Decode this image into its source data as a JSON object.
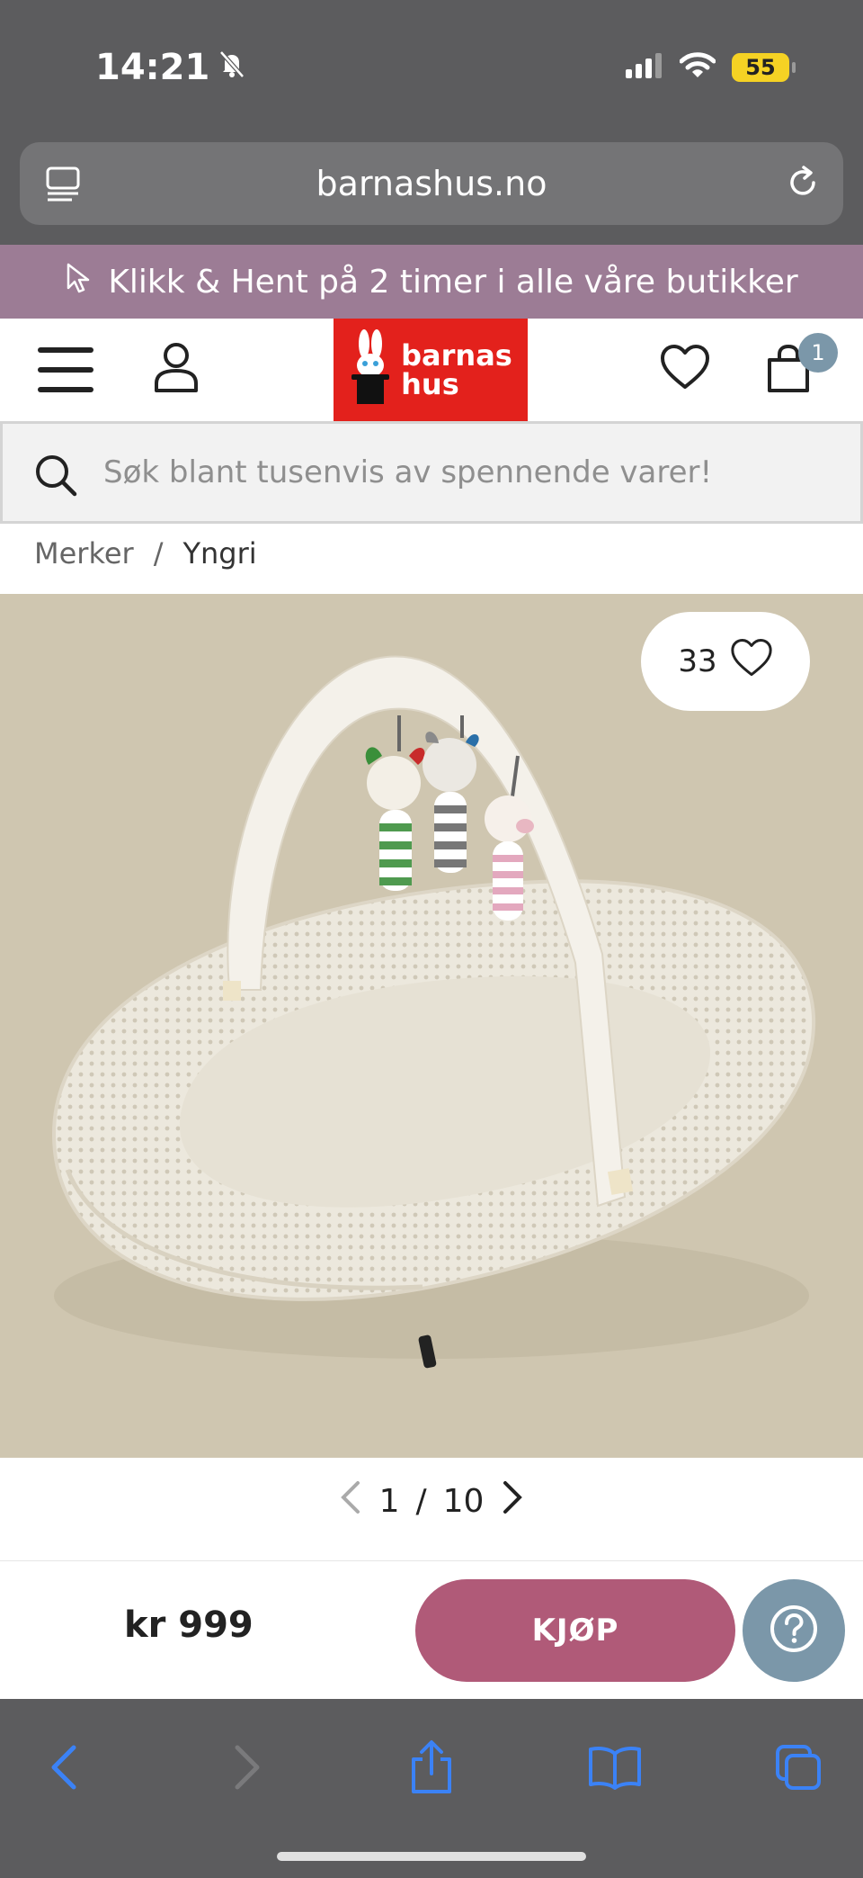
{
  "status_bar": {
    "time": "14:21",
    "battery": "55",
    "icons": [
      "bell-slash-icon",
      "cellular-signal-icon",
      "wifi-icon",
      "battery-icon"
    ]
  },
  "browser": {
    "url": "barnashus.no",
    "icons": [
      "tabs-list-icon",
      "reload-icon"
    ]
  },
  "promo_banner": {
    "text": "Klikk & Hent på 2 timer i alle våre butikker",
    "icon": "cursor-pointer-icon"
  },
  "header": {
    "logo_line1": "barnas",
    "logo_line2": "hus",
    "cart_count": "1",
    "icons": [
      "menu-icon",
      "user-icon",
      "heart-icon",
      "shopping-bag-icon"
    ],
    "brand_color": "#e3211c"
  },
  "search": {
    "placeholder": "Søk blant tusenvis av spennende varer!"
  },
  "breadcrumb": {
    "items": [
      "Merker",
      "Yngri"
    ],
    "separator": "/"
  },
  "product": {
    "favorite_count": "33",
    "image_index": "1",
    "image_total": "10",
    "image_separator": "/",
    "price": "kr 999",
    "buy_label": "KJØP"
  },
  "colors": {
    "promo": "#9c7c95",
    "buy_button": "#b05a78",
    "help_button": "#7b97a9",
    "browser_chrome": "#5c5c5e",
    "accent_blue": "#3b82f6"
  },
  "toolbar": {
    "icons": [
      "back-icon",
      "forward-icon",
      "share-icon",
      "bookmarks-icon",
      "tabs-icon"
    ]
  }
}
